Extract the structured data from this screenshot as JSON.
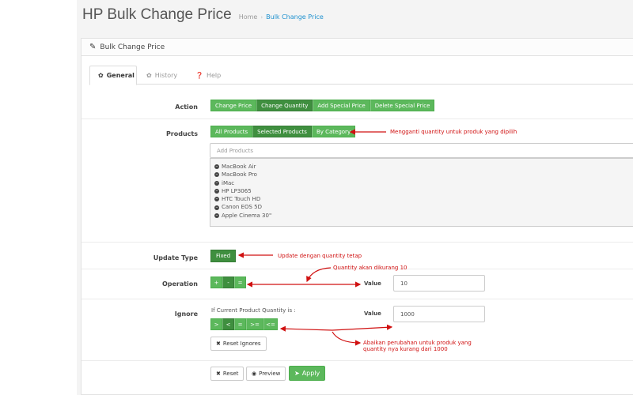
{
  "header": {
    "title": "HP Bulk Change Price",
    "breadcrumb_home": "Home",
    "breadcrumb_separator": "›",
    "breadcrumb_current": "Bulk Change Price"
  },
  "panel": {
    "heading": "Bulk Change Price",
    "heading_icon": "pencil-icon"
  },
  "tabs": [
    {
      "label": "General",
      "icon": "gear-icon",
      "active": true
    },
    {
      "label": "History",
      "icon": "gear-icon",
      "active": false
    },
    {
      "label": "Help",
      "icon": "question-icon",
      "active": false
    }
  ],
  "form": {
    "action": {
      "label": "Action",
      "buttons": [
        "Change Price",
        "Change Quantity",
        "Add Special Price",
        "Delete Special Price"
      ],
      "selected": "Change Quantity"
    },
    "products": {
      "label": "Products",
      "buttons": [
        "All Products",
        "Selected Products",
        "By Category"
      ],
      "selected": "Selected Products",
      "add_placeholder": "Add Products",
      "items": [
        "MacBook Air",
        "MacBook Pro",
        "iMac",
        "HP LP3065",
        "HTC Touch HD",
        "Canon EOS 5D",
        "Apple Cinema 30\""
      ]
    },
    "update_type": {
      "label": "Update Type",
      "button": "Fixed"
    },
    "operation": {
      "label": "Operation",
      "buttons": [
        "+",
        "-",
        "="
      ],
      "selected": "-",
      "value_label": "Value",
      "value": "10"
    },
    "ignore": {
      "label": "Ignore",
      "condition_text": "If Current Product Quantity is :",
      "buttons": [
        ">",
        "<",
        "=",
        ">=",
        "<="
      ],
      "value_label": "Value",
      "value": "1000",
      "reset_label": "Reset Ignores"
    },
    "footer": {
      "reset": "Reset",
      "preview": "Preview",
      "apply": "Apply"
    }
  },
  "annotations": {
    "products_note": "Mengganti quantity untuk produk yang dipilih",
    "update_type_note": "Update dengan quantity tetap",
    "operation_note": "Quantity akan dikurang 10",
    "ignore_note_line1": "Abaikan perubahan untuk produk yang",
    "ignore_note_line2": "quantity nya kurang dari 1000"
  },
  "colors": {
    "button_green": "#5cb85c",
    "button_selected": "#3f8f3f",
    "annotation_red": "#d01010",
    "link_blue": "#1e91cf"
  }
}
